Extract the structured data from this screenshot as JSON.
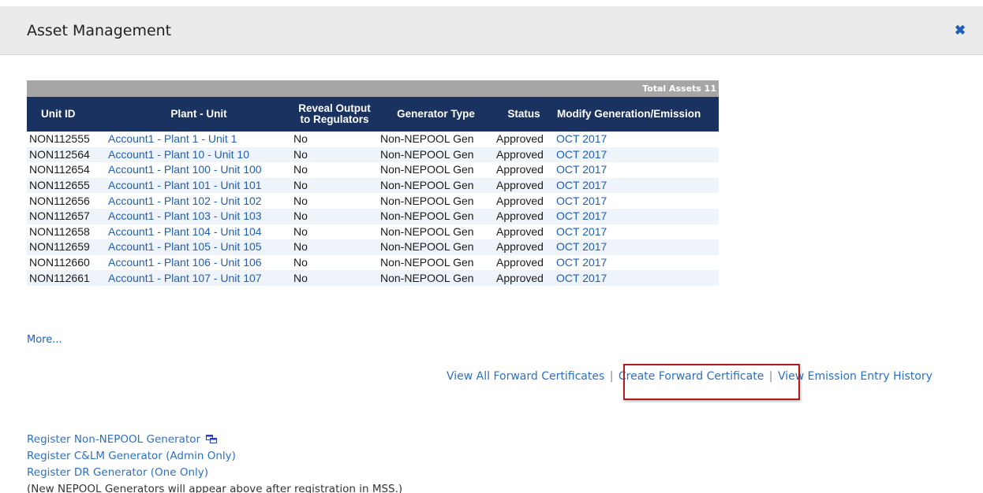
{
  "header": {
    "title": "Asset Management",
    "close_icon": "close-icon"
  },
  "assets": {
    "total_label": "Total Assets 11",
    "columns": [
      "Unit ID",
      "Plant - Unit",
      "Reveal Output to Regulators",
      "Generator Type",
      "Status",
      "Modify Generation/Emission"
    ],
    "rows": [
      {
        "unit_id": "NON112555",
        "plant_unit": "Account1 - Plant 1 - Unit 1",
        "reveal": "No",
        "gen_type": "Non-NEPOOL Gen",
        "status": "Approved",
        "modify": "OCT 2017"
      },
      {
        "unit_id": "NON112564",
        "plant_unit": "Account1 - Plant 10 - Unit 10",
        "reveal": "No",
        "gen_type": "Non-NEPOOL Gen",
        "status": "Approved",
        "modify": "OCT 2017"
      },
      {
        "unit_id": "NON112654",
        "plant_unit": "Account1 - Plant 100 - Unit 100",
        "reveal": "No",
        "gen_type": "Non-NEPOOL Gen",
        "status": "Approved",
        "modify": "OCT 2017"
      },
      {
        "unit_id": "NON112655",
        "plant_unit": "Account1 - Plant 101 - Unit 101",
        "reveal": "No",
        "gen_type": "Non-NEPOOL Gen",
        "status": "Approved",
        "modify": "OCT 2017"
      },
      {
        "unit_id": "NON112656",
        "plant_unit": "Account1 - Plant 102 - Unit 102",
        "reveal": "No",
        "gen_type": "Non-NEPOOL Gen",
        "status": "Approved",
        "modify": "OCT 2017"
      },
      {
        "unit_id": "NON112657",
        "plant_unit": "Account1 - Plant 103 - Unit 103",
        "reveal": "No",
        "gen_type": "Non-NEPOOL Gen",
        "status": "Approved",
        "modify": "OCT 2017"
      },
      {
        "unit_id": "NON112658",
        "plant_unit": "Account1 - Plant 104 - Unit 104",
        "reveal": "No",
        "gen_type": "Non-NEPOOL Gen",
        "status": "Approved",
        "modify": "OCT 2017"
      },
      {
        "unit_id": "NON112659",
        "plant_unit": "Account1 - Plant 105 - Unit 105",
        "reveal": "No",
        "gen_type": "Non-NEPOOL Gen",
        "status": "Approved",
        "modify": "OCT 2017"
      },
      {
        "unit_id": "NON112660",
        "plant_unit": "Account1 - Plant 106 - Unit 106",
        "reveal": "No",
        "gen_type": "Non-NEPOOL Gen",
        "status": "Approved",
        "modify": "OCT 2017"
      },
      {
        "unit_id": "NON112661",
        "plant_unit": "Account1 - Plant 107 - Unit 107",
        "reveal": "No",
        "gen_type": "Non-NEPOOL Gen",
        "status": "Approved",
        "modify": "OCT 2017"
      }
    ],
    "more_label": "More..."
  },
  "actions": {
    "view_forward": "View All Forward Certificates",
    "separator": "|",
    "create_forward": "Create Forward Certificate",
    "view_emission": "View Emission Entry History"
  },
  "register": {
    "non_nepool": "Register Non-NEPOOL Generator",
    "non_nepool_icon": "new-window-icon",
    "clm": "Register C&LM Generator (Admin Only)",
    "dr": "Register DR Generator (One Only)",
    "note": "(New NEPOOL Generators will appear above after registration in MSS.)"
  },
  "colors": {
    "header_bg": "#ebebeb",
    "table_header_bg": "#1a3260",
    "total_bar_bg": "#a6a6a6",
    "link": "#1f5fb5",
    "highlight": "#b01c1c"
  }
}
